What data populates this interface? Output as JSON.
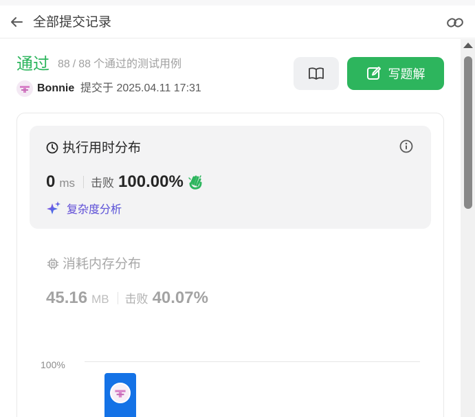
{
  "header": {
    "title": "全部提交记录"
  },
  "submission": {
    "status": "通过",
    "passed": "88",
    "separator": "/",
    "total": "88",
    "testcase_text": "个通过的测试用例",
    "user": "Bonnie",
    "submitted_text": "提交于 2025.04.11 17:31"
  },
  "actions": {
    "write_solution": "写题解"
  },
  "runtime": {
    "title": "执行用时分布",
    "value": "0",
    "unit": "ms",
    "beats_label": "击败",
    "beats_value": "100.00%",
    "complexity_label": "复杂度分析"
  },
  "memory": {
    "title": "消耗内存分布",
    "value": "45.16",
    "unit": "MB",
    "beats_label": "击败",
    "beats_value": "40.07%"
  },
  "chart": {
    "tick_top": "100%"
  },
  "colors": {
    "accent_green": "#2db55d",
    "bar_blue": "#1472e6"
  }
}
